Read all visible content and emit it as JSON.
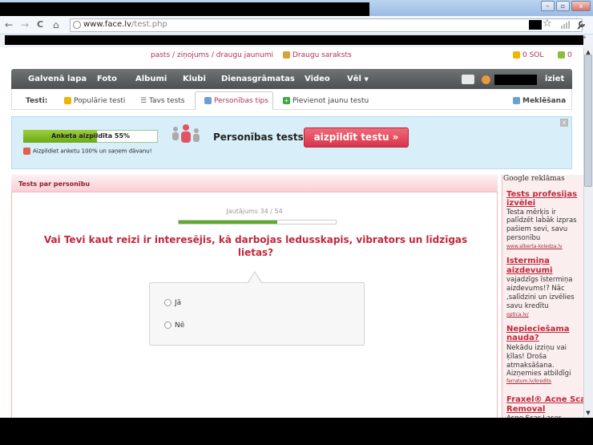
{
  "browser": {
    "url_domain": "www.face.lv",
    "url_path": "/test.php",
    "back": "←",
    "forward": "→",
    "reload": "C",
    "home": "⌂",
    "minimize": "–",
    "maximize": "▫",
    "close_window": "x",
    "star": "☆",
    "menu_chevron": "»"
  },
  "toplinks": {
    "links": "pasts / ziņojums / draugu jaunumi",
    "friends": "Draugu saraksts",
    "sol": "0 SOL",
    "coins": "0"
  },
  "mainnav": {
    "items": [
      "Galvenā lapa",
      "Foto",
      "Albumi",
      "Klubi",
      "Dienasgrāmatas",
      "Video",
      "Vēl"
    ],
    "logout": "iziet"
  },
  "subnav": {
    "label": "Testi:",
    "popular": "Populārie testi",
    "yours": "Tavs tests",
    "personality": "Personības tips",
    "add": "Pievienot jaunu testu",
    "search": "Meklēšana"
  },
  "banner": {
    "progress_text": "Anketa aizpildīta 55%",
    "progress_fraction": 0.55,
    "gift_text": "Aizpildiet anketu 100% un saņem dāvanu!",
    "title": "Personības tests",
    "button": "aizpildīt testu »",
    "close": "x"
  },
  "panel": {
    "title": "Tests par personību",
    "question_counter": "Jautājums 34 / 54",
    "question_progress": 0.63,
    "question": "Vai Tevi kaut reizi ir interesējis, kā darbojas ledusskapis, vibrators un līdzīgas lietas?",
    "options": [
      "Jā",
      "Nē"
    ]
  },
  "ads": {
    "header": "Google reklāmas",
    "items": [
      {
        "title_lines": [
          "Tests profesijas",
          "izvēlei"
        ],
        "desc_lines": [
          "Testa mērķis ir",
          "palīdzēt labāk izpras",
          "pašiem sevi, savu",
          "personību"
        ],
        "url": "www.alberta-koledza.lv"
      },
      {
        "title_lines": [
          "Istermiņa",
          "aizdevumi"
        ],
        "desc_lines": [
          "vajadzīgs īstermiņa",
          "aizdevums!? Nāc",
          ",salīdzini un izvēlies",
          "savu kredītu"
        ],
        "url": "optica.lv/"
      },
      {
        "title_lines": [
          "Nepieciešama",
          "nauda?"
        ],
        "desc_lines": [
          "Nekādu izziņu vai",
          "ķīlas! Droša",
          "atmaksāšana.",
          "Aizņemies atbildīgi"
        ],
        "url": "ferratum.lv/kredits"
      },
      {
        "title_lines": [
          "Fraxel® Acne Sca",
          "Removal"
        ],
        "desc_lines": [
          "Acne Scar Laser"
        ],
        "url": ""
      }
    ]
  },
  "colors": {
    "accent_red": "#c0283c",
    "nav_bg": "#5a5e5f",
    "progress_green": "#6bab17",
    "banner_bg": "#d8eef8"
  }
}
